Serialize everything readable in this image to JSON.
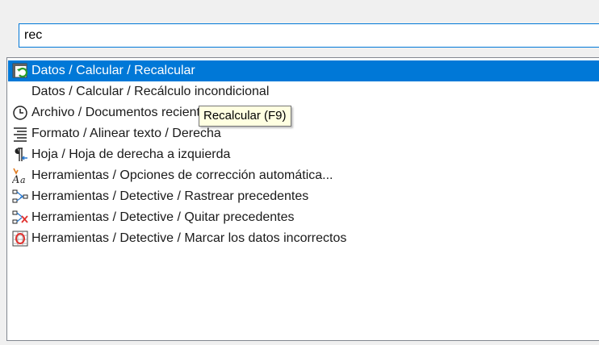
{
  "search": {
    "value": "rec"
  },
  "results": [
    {
      "label": "Datos / Calcular / Recalcular",
      "icon": "recalculate-icon",
      "selected": true
    },
    {
      "label": "Datos / Calcular / Recálculo incondicional",
      "icon": "",
      "selected": false
    },
    {
      "label": "Archivo / Documentos recientes",
      "icon": "clock-icon",
      "selected": false
    },
    {
      "label": "Formato / Alinear texto / Derecha",
      "icon": "align-right-icon",
      "selected": false
    },
    {
      "label": "Hoja / Hoja de derecha a izquierda",
      "icon": "right-to-left-icon",
      "selected": false
    },
    {
      "label": "Herramientas / Opciones de corrección automática...",
      "icon": "autocorrect-icon",
      "selected": false
    },
    {
      "label": "Herramientas / Detective / Rastrear precedentes",
      "icon": "trace-precedents-icon",
      "selected": false
    },
    {
      "label": "Herramientas / Detective / Quitar precedentes",
      "icon": "remove-precedents-icon",
      "selected": false
    },
    {
      "label": "Herramientas / Detective / Marcar los datos incorrectos",
      "icon": "mark-invalid-data-icon",
      "selected": false
    }
  ],
  "tooltip": {
    "text": "Recalcular (F9)"
  },
  "colors": {
    "selection": "#0078d7",
    "tooltip_bg": "#ffffe1",
    "focus_border": "#0078d7"
  }
}
